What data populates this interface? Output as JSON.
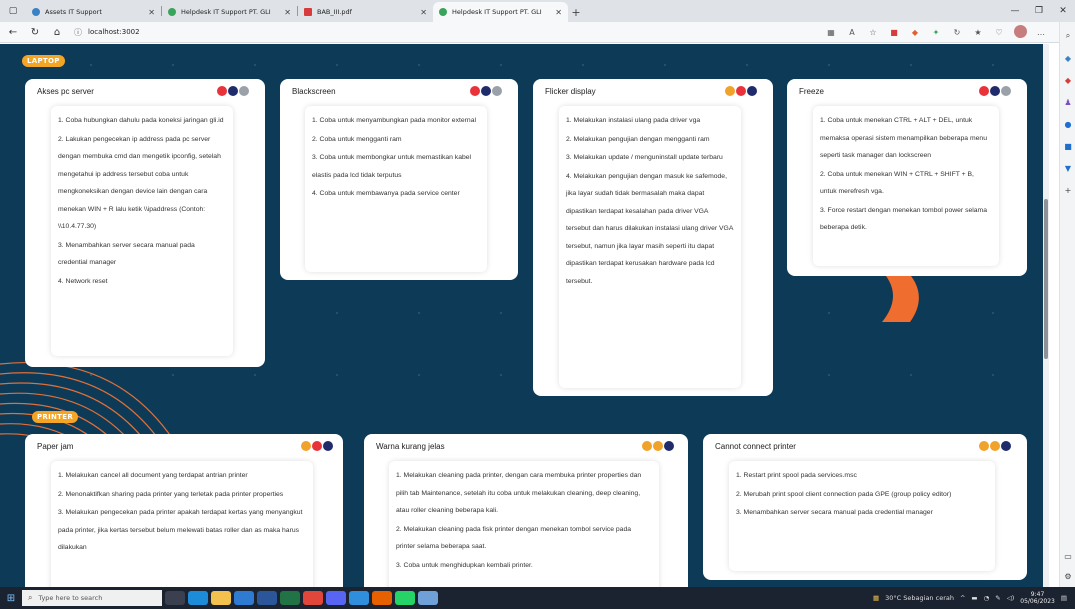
{
  "browser": {
    "tabs": [
      {
        "title": "Assets IT Support",
        "active": false,
        "favicon_color": "#3b82c4"
      },
      {
        "title": "Helpdesk IT Support PT. GLI",
        "active": false,
        "favicon_color": "#3aa45a"
      },
      {
        "title": "BAB_III.pdf",
        "active": false,
        "favicon_color": "#d83b3b"
      },
      {
        "title": "Helpdesk IT Support PT. GLI",
        "active": true,
        "favicon_color": "#3aa45a"
      }
    ],
    "new_tab_label": "+",
    "url": "localhost:3002"
  },
  "sections": {
    "laptop_label": "LAPTOP",
    "printer_label": "PRINTER"
  },
  "cards": {
    "akses": {
      "title": "Akses pc server",
      "steps": [
        "1. Coba hubungkan dahulu pada koneksi jaringan gli.id",
        "2. Lakukan pengecekan ip address pada pc server dengan membuka cmd dan mengetik ipconfig, setelah mengetahui ip address tersebut coba untuk mengkoneksikan dengan device lain dengan cara menekan WIN + R lalu ketik \\\\ipaddress (Contoh: \\\\10.4.77.30)",
        "3. Menambahkan server secara manual pada credential manager",
        "4. Network reset"
      ]
    },
    "blackscreen": {
      "title": "Blackscreen",
      "steps": [
        "1. Coba untuk menyambungkan pada monitor external",
        "2. Coba untuk mengganti ram",
        "3. Coba untuk membongkar untuk memastikan kabel elastis pada lcd tidak terputus",
        "4. Coba untuk membawanya pada service center"
      ]
    },
    "flicker": {
      "title": "Flicker display",
      "steps": [
        "1. Melakukan instalasi ulang pada driver vga",
        "2. Melakukan pengujian dengan mengganti ram",
        "3. Melakukan update / menguninstall update terbaru",
        "4. Melakukan pengujian dengan masuk ke safemode, jika layar sudah tidak bermasalah maka dapat dipastikan terdapat kesalahan pada driver VGA tersebut dan harus dilakukan instalasi ulang driver VGA tersebut, namun jika layar masih seperti itu dapat dipastikan terdapat kerusakan hardware pada lcd tersebut."
      ]
    },
    "freeze": {
      "title": "Freeze",
      "steps": [
        "1. Coba untuk menekan CTRL + ALT + DEL, untuk memaksa operasi sistem menampilkan beberapa menu seperti task manager dan lockscreen",
        "2. Coba untuk menekan WIN + CTRL + SHIFT + B, untuk merefresh vga.",
        "3. Force restart dengan menekan tombol power selama beberapa detik."
      ]
    },
    "paperjam": {
      "title": "Paper jam",
      "steps": [
        "1. Melakukan cancel all document yang terdapat antrian printer",
        "2. Menonaktifkan sharing pada printer yang terletak pada printer properties",
        "3. Melakukan pengecekan pada printer apakah terdapat kertas yang menyangkut pada printer, jika kertas tersebut belum melewati batas roller dan as maka harus dilakukan"
      ]
    },
    "warna": {
      "title": "Warna kurang jelas",
      "steps": [
        "1. Melakukan cleaning pada printer, dengan cara membuka printer properties dan pilih tab Maintenance, setelah itu coba untuk melakukan cleaning, deep cleaning, atau roller cleaning beberapa kali.",
        "2. Melakukan cleaning pada fisk printer dengan menekan tombol service pada printer selama beberapa saat.",
        "3. Coba untuk menghidupkan kembali printer."
      ]
    },
    "cannot": {
      "title": "Cannot connect printer",
      "steps": [
        "1. Restart print spool pada services.msc",
        "2. Merubah print spool client connection pada GPE (group policy editor)",
        "3. Menambahkan server secara manual pada credential manager"
      ]
    }
  },
  "taskbar": {
    "search_placeholder": "Type here to search",
    "weather": "30°C  Sebagian cerah",
    "time": "9:47",
    "date": "05/06/2023"
  },
  "colors": {
    "page_bg": "#0c3a57",
    "accent_orange": "#f5a524",
    "dot_red": "#e8333a",
    "dot_navy": "#1f2b6b"
  }
}
